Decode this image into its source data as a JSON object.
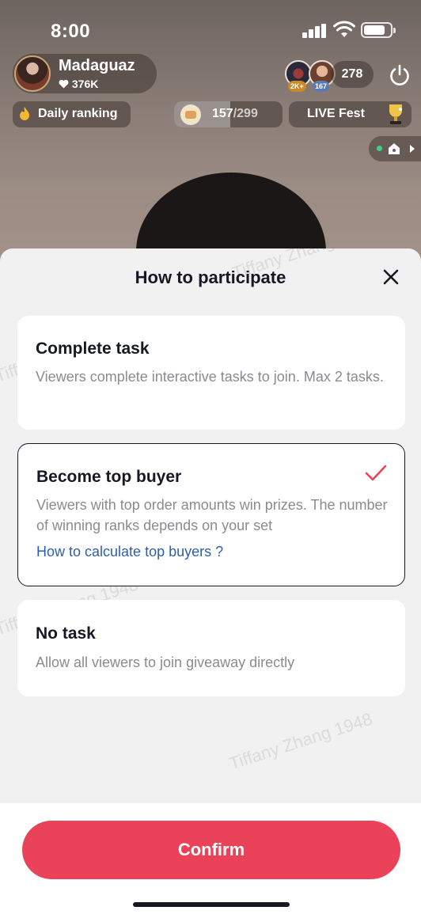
{
  "status_bar": {
    "time": "8:00"
  },
  "host": {
    "name": "Madaguaz",
    "likes": "376K"
  },
  "viewers": {
    "badge_1": "2K+",
    "badge_2": "167",
    "count": "278"
  },
  "daily_ranking": {
    "label": "Daily ranking"
  },
  "progress": {
    "current": "157",
    "total": "/299",
    "fraction": 0.52
  },
  "live_fest": {
    "label": "LIVE Fest"
  },
  "sheet": {
    "title": "How to participate",
    "options": [
      {
        "title": "Complete task",
        "description": "Viewers complete interactive tasks to join. Max 2 tasks.",
        "selected": false
      },
      {
        "title": "Become top buyer",
        "description": "Viewers with top order amounts win prizes. The number of winning ranks depends on your set",
        "link": "How to calculate top buyers ?",
        "selected": true
      },
      {
        "title": "No task",
        "description": "Allow all viewers to join giveaway directly",
        "selected": false
      }
    ],
    "confirm_label": "Confirm"
  },
  "watermark": "Tiffany Zhang 1948",
  "colors": {
    "accent": "#ea4359",
    "link": "#2d5fae",
    "check": "#ea4359"
  }
}
